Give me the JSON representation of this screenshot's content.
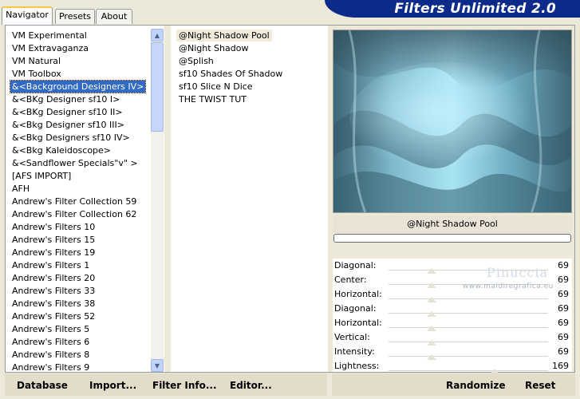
{
  "tabs": [
    "Navigator",
    "Presets",
    "About"
  ],
  "header_title": "Filters Unlimited 2.0",
  "categories": [
    "VM Experimental",
    "VM Extravaganza",
    "VM Natural",
    "VM Toolbox",
    "&<Background Designers IV>",
    "&<BKg Designer sf10 I>",
    "&<BKg Designer sf10 II>",
    "&<Bkg Designer sf10 III>",
    "&<Bkg Designers sf10 IV>",
    "&<Bkg Kaleidoscope>",
    "&<Sandflower Specials\"v\" >",
    "[AFS IMPORT]",
    "AFH",
    "Andrew's Filter Collection 59",
    "Andrew's Filter Collection 62",
    "Andrew's Filters 10",
    "Andrew's Filters 15",
    "Andrew's Filters 19",
    "Andrew's Filters 1",
    "Andrew's Filters 20",
    "Andrew's Filters 33",
    "Andrew's Filters 38",
    "Andrew's Filters 52",
    "Andrew's Filters 5",
    "Andrew's Filters 6",
    "Andrew's Filters 8",
    "Andrew's Filters 9"
  ],
  "selected_category_index": 4,
  "filters": [
    "@Night Shadow Pool",
    "@Night Shadow",
    "@Splish",
    "sf10 Shades Of Shadow",
    "sf10 Slice N Dice",
    "THE TWIST TUT"
  ],
  "selected_filter_index": 0,
  "current_filter_name": "@Night Shadow Pool",
  "progress": 0,
  "parameters": [
    {
      "label": "Diagonal:",
      "value": "69"
    },
    {
      "label": "Center:",
      "value": "69"
    },
    {
      "label": "Horizontal:",
      "value": "69"
    },
    {
      "label": "Diagonal:",
      "value": "69"
    },
    {
      "label": "Horizontal:",
      "value": "69"
    },
    {
      "label": "Vertical:",
      "value": "69"
    },
    {
      "label": "Intensity:",
      "value": "69"
    },
    {
      "label": "Lightness:",
      "value": "169"
    }
  ],
  "watermark": {
    "name": "Pinuccia",
    "site": "www.maidiregrafica.eu"
  },
  "buttons": {
    "database": "Database",
    "import": "Import...",
    "filter_info": "Filter Info...",
    "editor": "Editor...",
    "randomize": "Randomize",
    "reset": "Reset"
  },
  "colors": {
    "header": "#0b2a8a",
    "selection": "#316ac5",
    "accent_tab": "#ffc83c"
  }
}
